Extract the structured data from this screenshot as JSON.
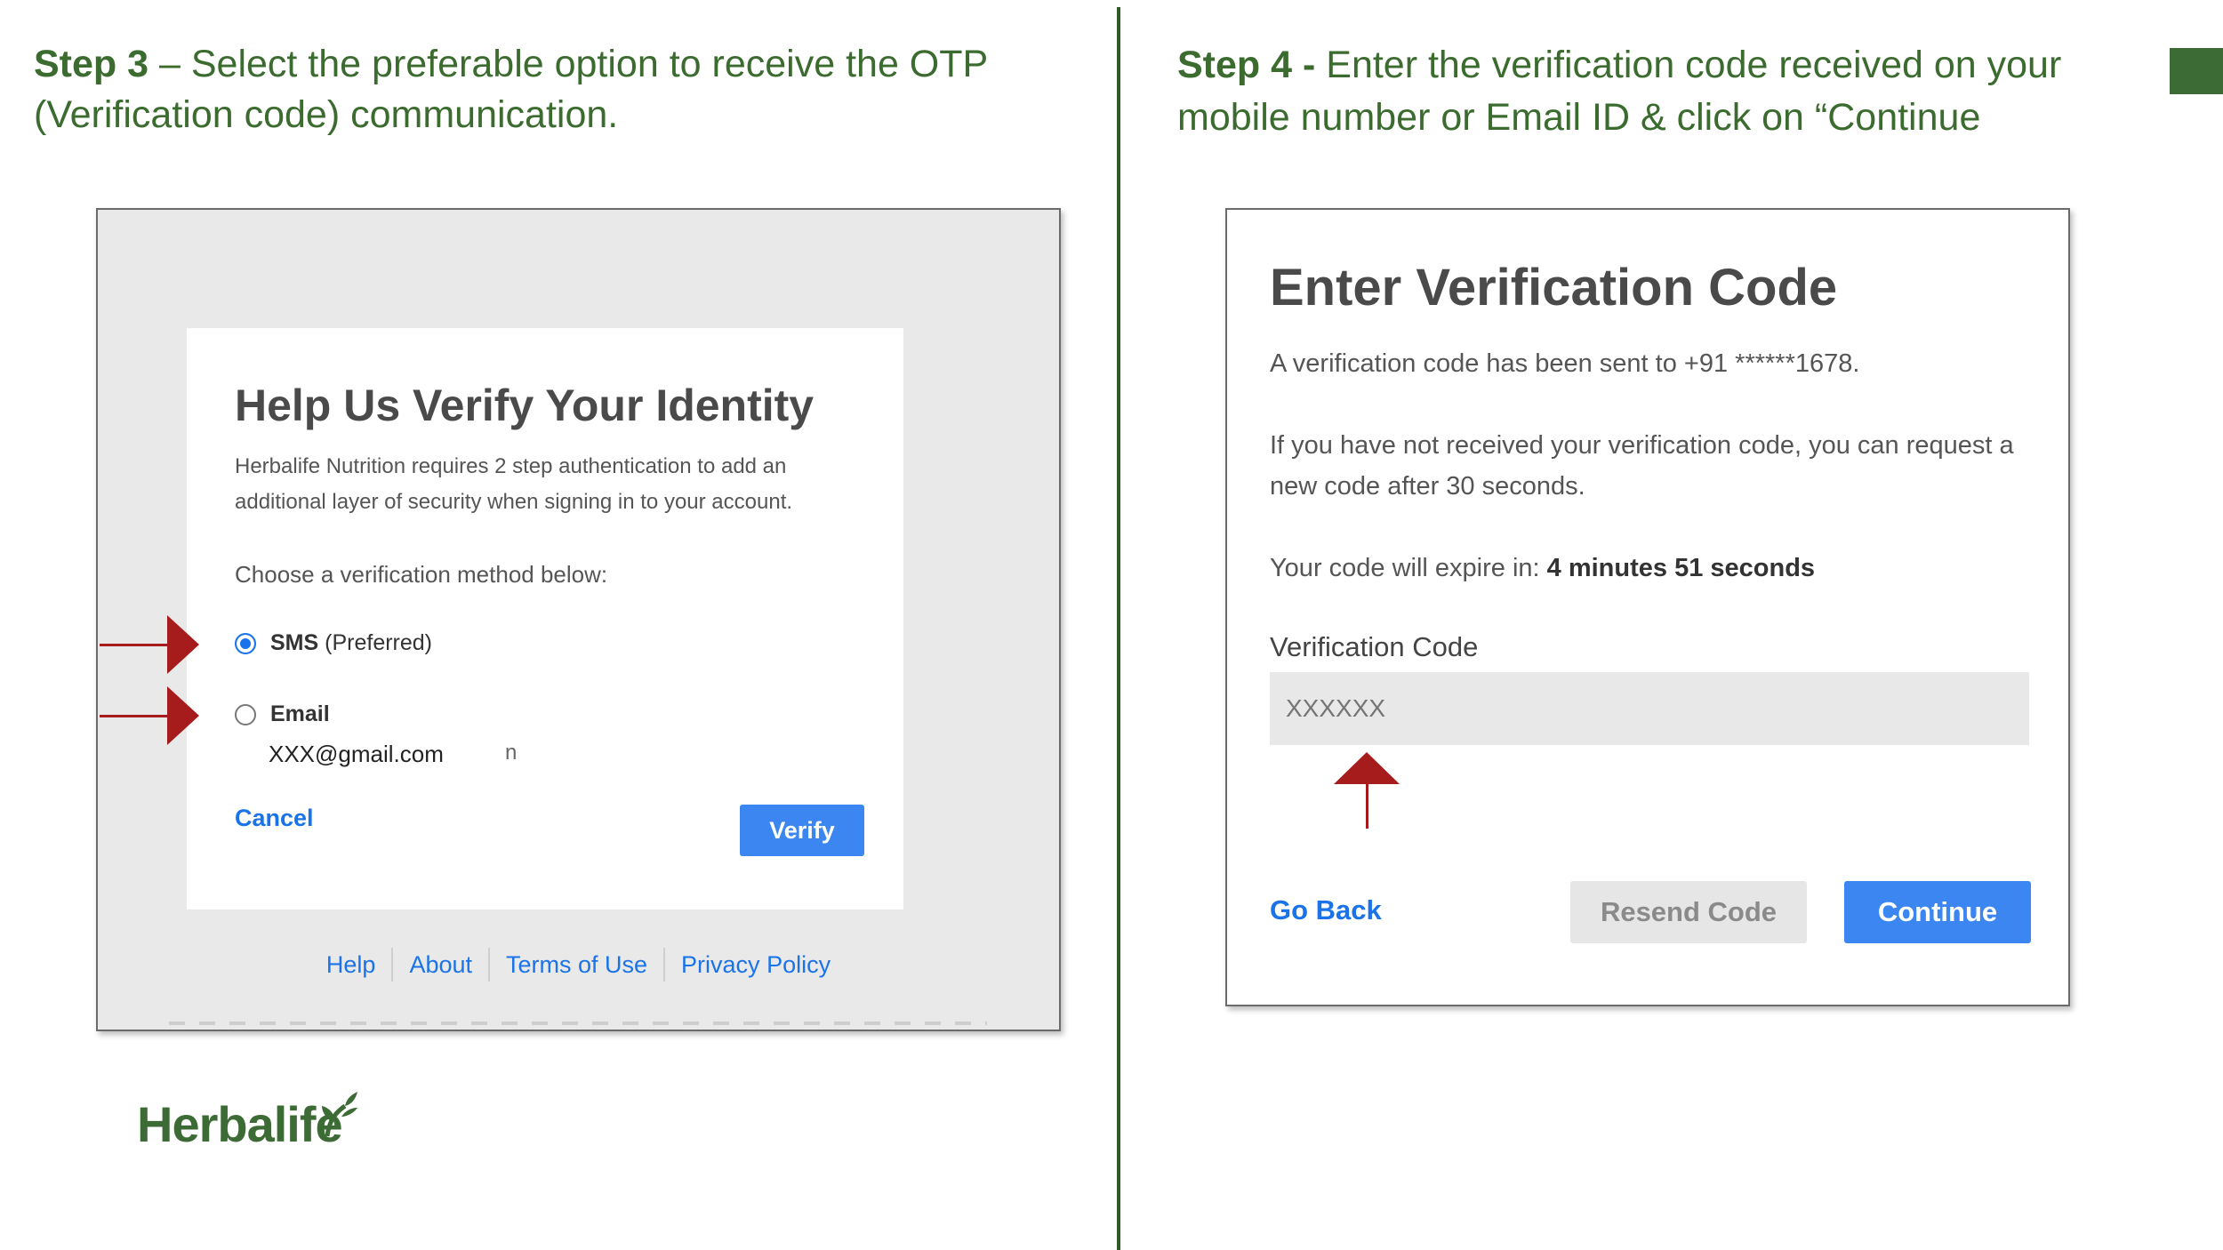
{
  "step3": {
    "label": "Step 3",
    "text": " – Select the preferable option to receive the OTP (Verification code) communication."
  },
  "step4": {
    "label": "Step 4 -",
    "text": " Enter the verification code received on  your mobile number or Email ID & click on “Continue"
  },
  "identity_card": {
    "title": "Help Us Verify Your Identity",
    "description": "Herbalife Nutrition requires 2 step authentication to add an additional layer of security when signing in to your account.",
    "choose_prompt": "Choose a verification method below:",
    "option_sms_label": "SMS",
    "option_sms_note": "(Preferred)",
    "option_email_label": "Email",
    "email_address": "XXX@gmail.com",
    "stray_mark": "n",
    "cancel_label": "Cancel",
    "verify_label": "Verify",
    "selected_option": "SMS"
  },
  "footer_links": [
    "Help",
    "About",
    "Terms of Use",
    "Privacy Policy"
  ],
  "verification_card": {
    "title": "Enter Verification Code",
    "sent_to": "A verification code has been sent to +91 ******1678.",
    "resend_info": "If you have not received your verification code, you can request a new code after 30 seconds.",
    "expire_prefix": "Your code will expire in: ",
    "expire_value": "4 minutes 51 seconds",
    "field_label": "Verification Code",
    "field_placeholder": "XXXXXX",
    "go_back_label": "Go Back",
    "resend_label": "Resend Code",
    "continue_label": "Continue"
  },
  "brand": {
    "logo_text": "Herbalife"
  },
  "colors": {
    "heading_green": "#3b6b2f",
    "arrow_red": "#a61c1c",
    "button_blue": "#3b86f0",
    "link_blue": "#1a73e8"
  }
}
